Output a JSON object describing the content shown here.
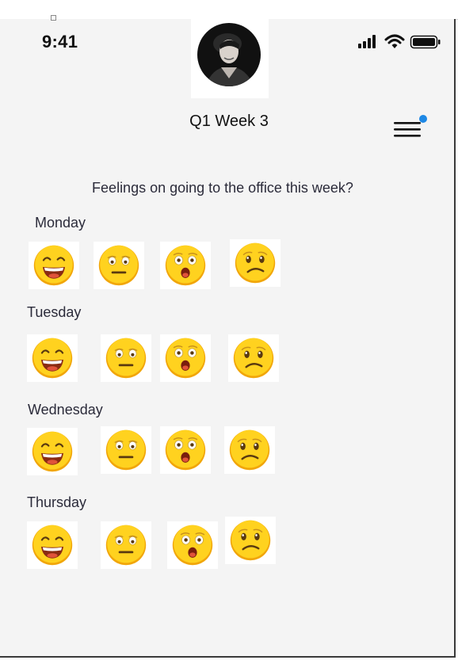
{
  "status_bar": {
    "time": "9:41"
  },
  "header": {
    "title": "Q1 Week 3"
  },
  "survey": {
    "question": "Feelings on going to the office this week?",
    "days": [
      {
        "label": "Monday"
      },
      {
        "label": "Tuesday"
      },
      {
        "label": "Wednesday"
      },
      {
        "label": "Thursday"
      }
    ],
    "options": [
      "grinning-emoji",
      "neutral-emoji",
      "astonished-emoji",
      "worried-emoji"
    ]
  },
  "colors": {
    "emoji_face": "#ffd21f",
    "emoji_shade": "#f1a60a",
    "notification_dot": "#1e88e5"
  }
}
